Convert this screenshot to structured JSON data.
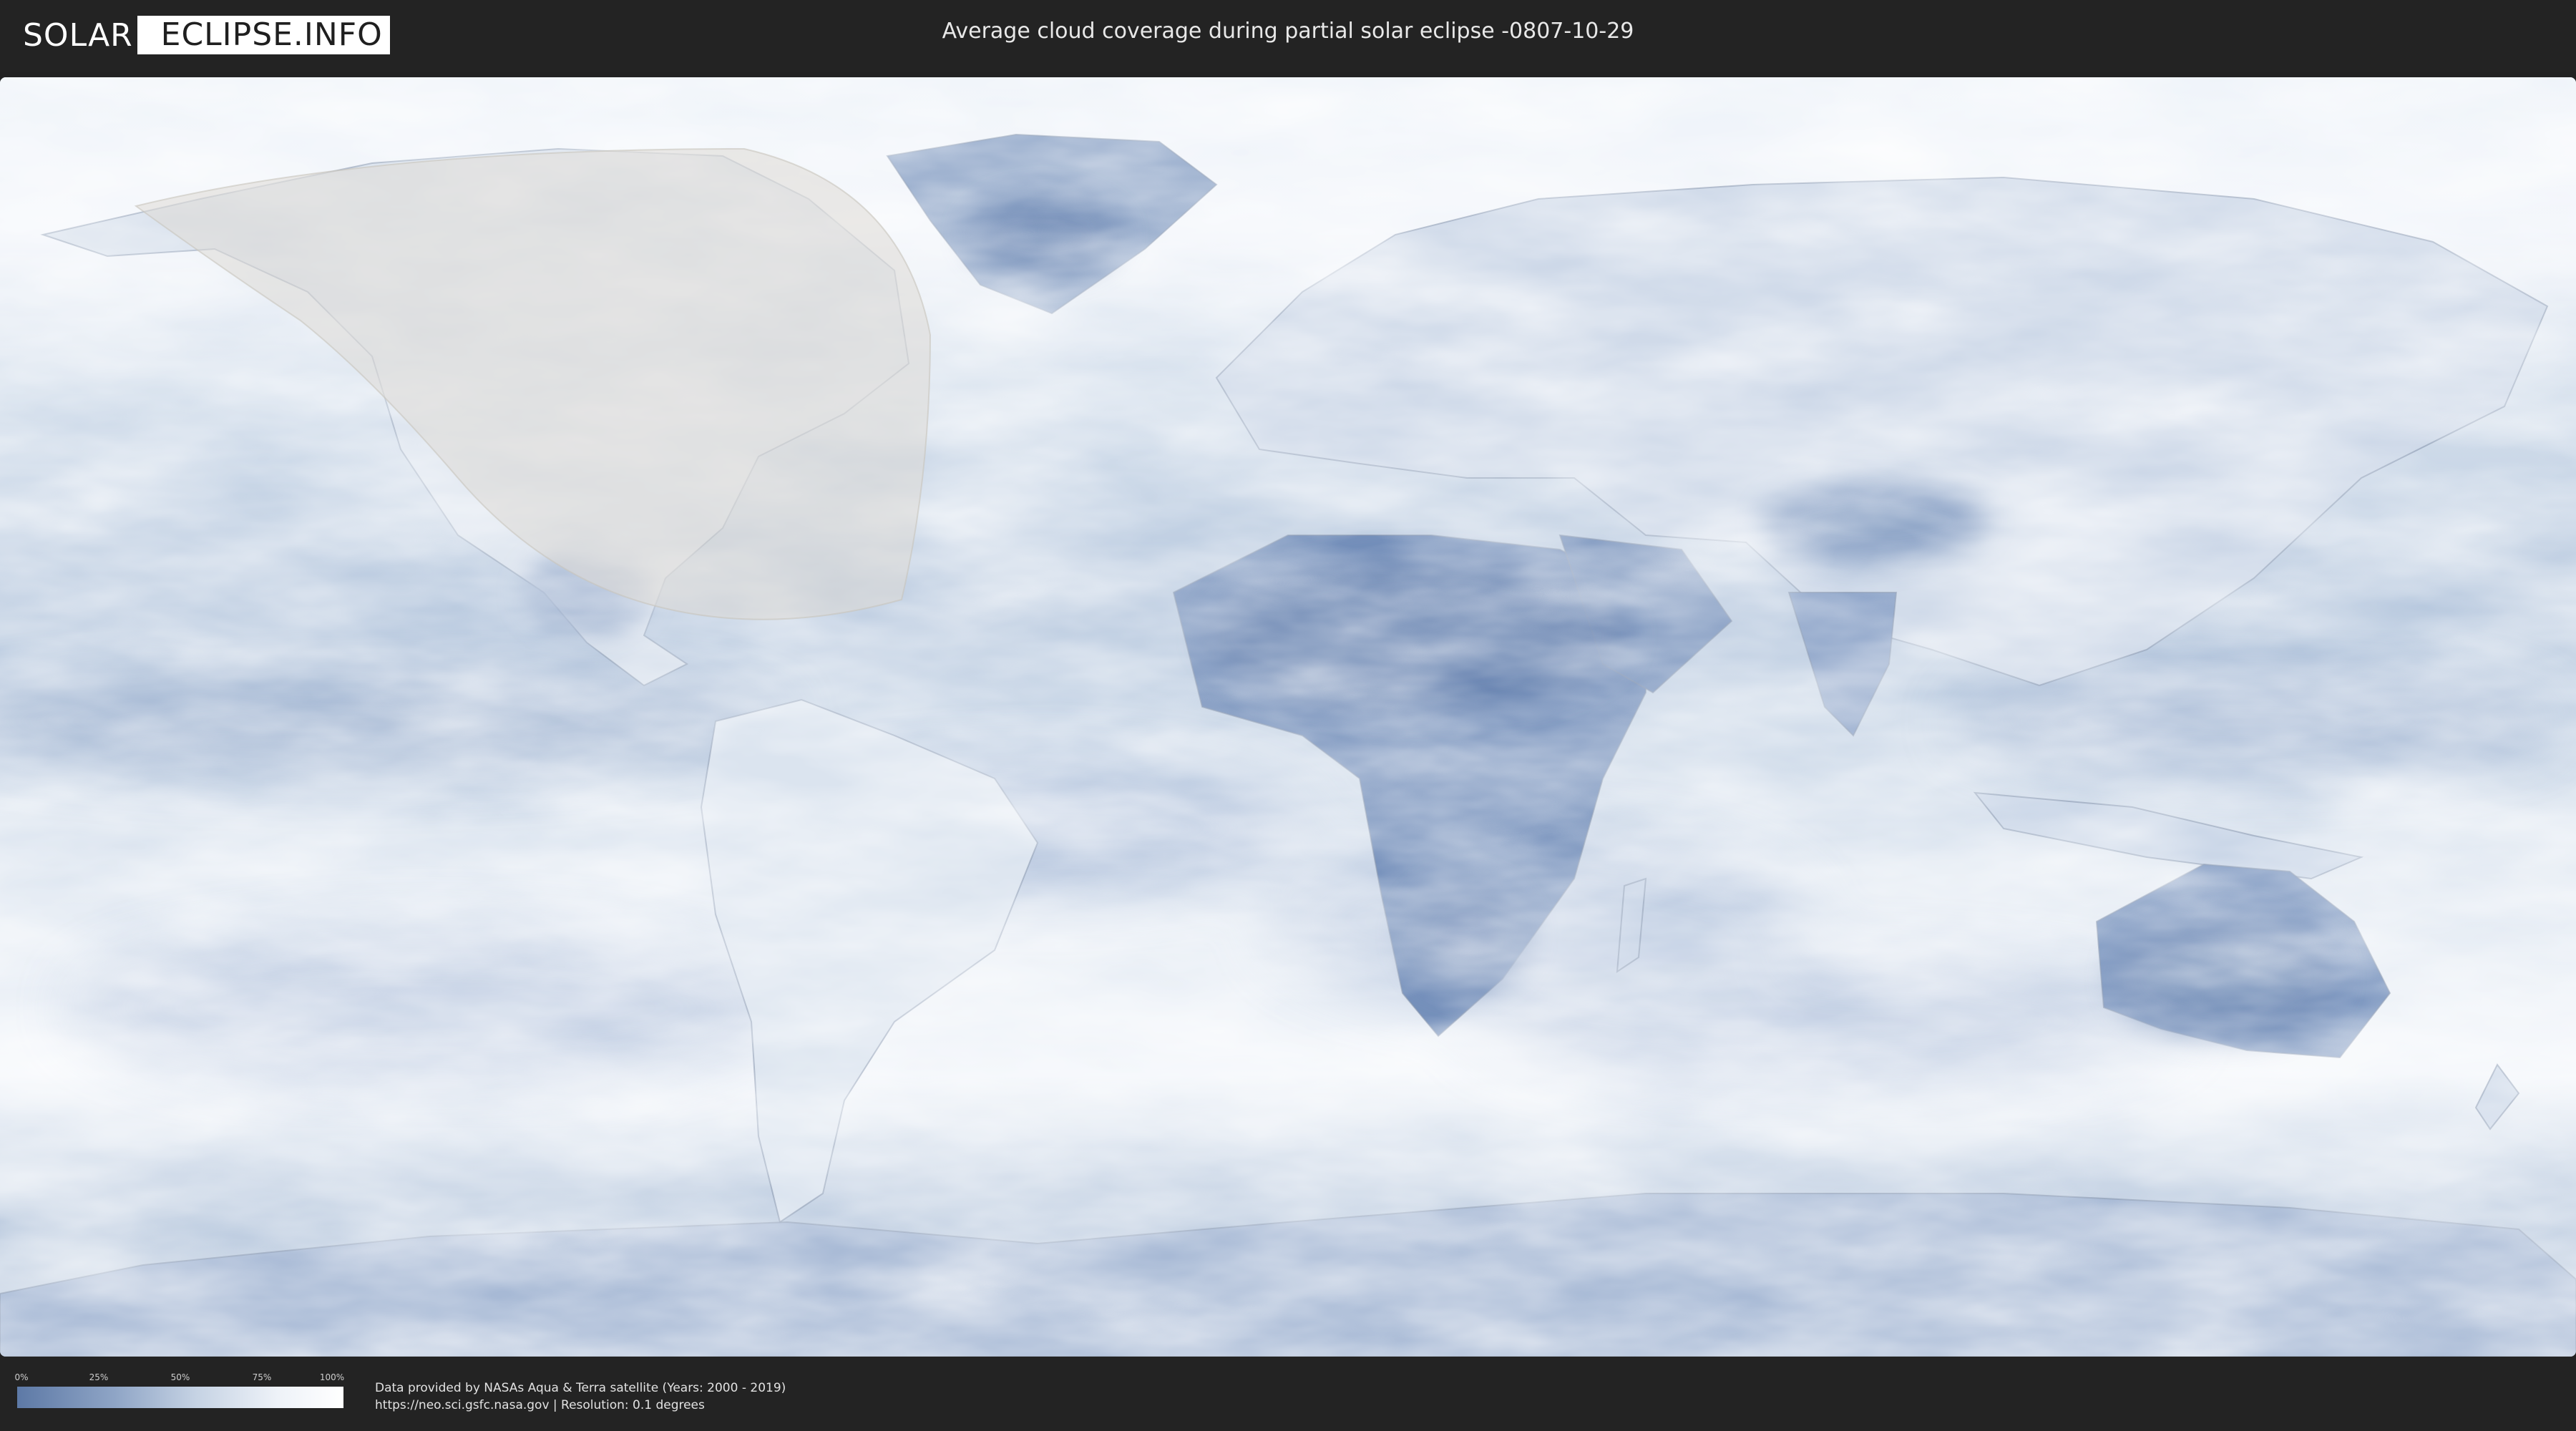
{
  "header": {
    "logo": {
      "part_a": "SOLAR",
      "part_b": "ECLIPSE.INFO"
    },
    "title": "Average cloud coverage during partial solar eclipse -0807-10-29"
  },
  "map": {
    "projection": "equirectangular",
    "colors": {
      "ocean_clear": "#cdd9e8",
      "cloud_dense": "#ffffff",
      "clear_sky": "#5d79a6",
      "eclipse_overlay": "#d9d6d0"
    },
    "eclipse_zone": "partial eclipse visibility region (North America / North Atlantic)"
  },
  "legend": {
    "ticks": [
      "0%",
      "25%",
      "50%",
      "75%",
      "100%"
    ],
    "gradient": [
      "#5d79a6",
      "#8fa5c6",
      "#c6d3e4",
      "#eef2f8",
      "#ffffff"
    ]
  },
  "footer": {
    "credit_line1": "Data provided by NASAs Aqua & Terra satellite (Years: 2000 - 2019)",
    "credit_line2": "https://neo.sci.gsfc.nasa.gov | Resolution: 0.1 degrees"
  }
}
